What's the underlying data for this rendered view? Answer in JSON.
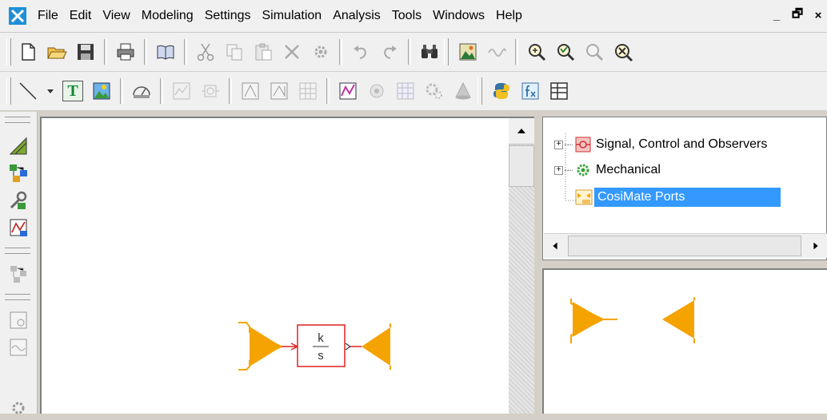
{
  "menu": {
    "items": [
      "File",
      "Edit",
      "View",
      "Modeling",
      "Settings",
      "Simulation",
      "Analysis",
      "Tools",
      "Windows",
      "Help"
    ],
    "window_controls": [
      "_",
      "🗗",
      "×"
    ]
  },
  "toolbar1": {
    "icons": [
      "new-file-icon",
      "open-folder-icon",
      "save-icon",
      "print-icon",
      "book-icon",
      "cut-icon",
      "copy-icon",
      "paste-icon",
      "delete-icon",
      "gear-icon",
      "undo-icon",
      "redo-icon",
      "binoculars-icon",
      "image-icon",
      "wave-icon",
      "zoom-in-icon",
      "zoom-out-icon",
      "zoom-fit-icon",
      "zoom-all-icon"
    ]
  },
  "toolbar2": {
    "icons": [
      "line-tool-icon",
      "dropdown-arrow-icon",
      "text-tool-icon",
      "picture-tool-icon",
      "gauge-icon",
      "plot-icon",
      "block-icon",
      "signal-icon",
      "step-icon",
      "table-icon",
      "chart-icon",
      "component-icon",
      "grid-icon",
      "cogs-icon",
      "cone-icon",
      "python-icon",
      "function-icon",
      "spreadsheet-icon"
    ],
    "text_tool_label": "T"
  },
  "library_tree": {
    "items": [
      {
        "label": "Signal, Control and Observers",
        "expanded": false
      },
      {
        "label": "Mechanical",
        "expanded": false
      },
      {
        "label": "CosiMate Ports",
        "selected": true
      }
    ],
    "toggle_symbol": "+"
  },
  "canvas": {
    "block": {
      "numerator": "k",
      "denominator": "s"
    }
  },
  "colors": {
    "port": "#f5a300",
    "block_border": "#e02020",
    "selection": "#3399ff",
    "chrome": "#f0f0f0"
  }
}
